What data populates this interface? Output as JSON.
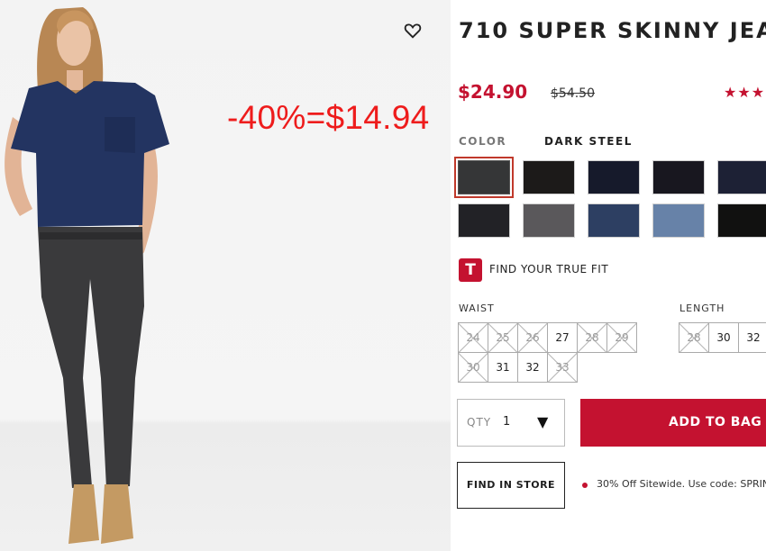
{
  "annotation": {
    "discount_text": "-40%=$14.94"
  },
  "product": {
    "title": "710 SUPER SKINNY JEA",
    "sale_price": "$24.90",
    "original_price": "$54.50",
    "rating_stars": "★★★"
  },
  "color": {
    "label": "COLOR",
    "selected_name": "DARK STEEL",
    "swatches": [
      "dark-steel",
      "black-rinse",
      "dark-indigo",
      "midnight",
      "deep-navy",
      "black-wash",
      "smoke-grey",
      "medium-blue",
      "light-blue",
      "jet-black"
    ],
    "swatch_colors": [
      "#353637",
      "#1c1a19",
      "#161a2b",
      "#18171f",
      "#1d2135",
      "#222226",
      "#5a585b",
      "#2d3f62",
      "#6782a8",
      "#111110"
    ]
  },
  "fit": {
    "badge_letter": "T",
    "label": "FIND YOUR TRUE FIT"
  },
  "waist": {
    "label": "WAIST",
    "sizes": [
      {
        "value": "24",
        "available": false
      },
      {
        "value": "25",
        "available": false
      },
      {
        "value": "26",
        "available": false
      },
      {
        "value": "27",
        "available": true
      },
      {
        "value": "28",
        "available": false
      },
      {
        "value": "29",
        "available": false
      },
      {
        "value": "30",
        "available": false
      },
      {
        "value": "31",
        "available": true
      },
      {
        "value": "32",
        "available": true
      },
      {
        "value": "33",
        "available": false
      }
    ]
  },
  "length": {
    "label": "LENGTH",
    "sizes": [
      {
        "value": "28",
        "available": false
      },
      {
        "value": "30",
        "available": true
      },
      {
        "value": "32",
        "available": true
      }
    ]
  },
  "purchase": {
    "qty_label": "QTY",
    "qty_value": "1",
    "add_to_bag": "ADD TO BAG",
    "find_in_store": "FIND IN STORE",
    "promo": "30% Off Sitewide. Use code: SPRIN"
  },
  "colors": {
    "brand_red": "#c41230",
    "annotation_red": "#ee1c1c"
  },
  "icons": {
    "wishlist": "heart-outline-icon",
    "qty": "caret-down-icon"
  }
}
